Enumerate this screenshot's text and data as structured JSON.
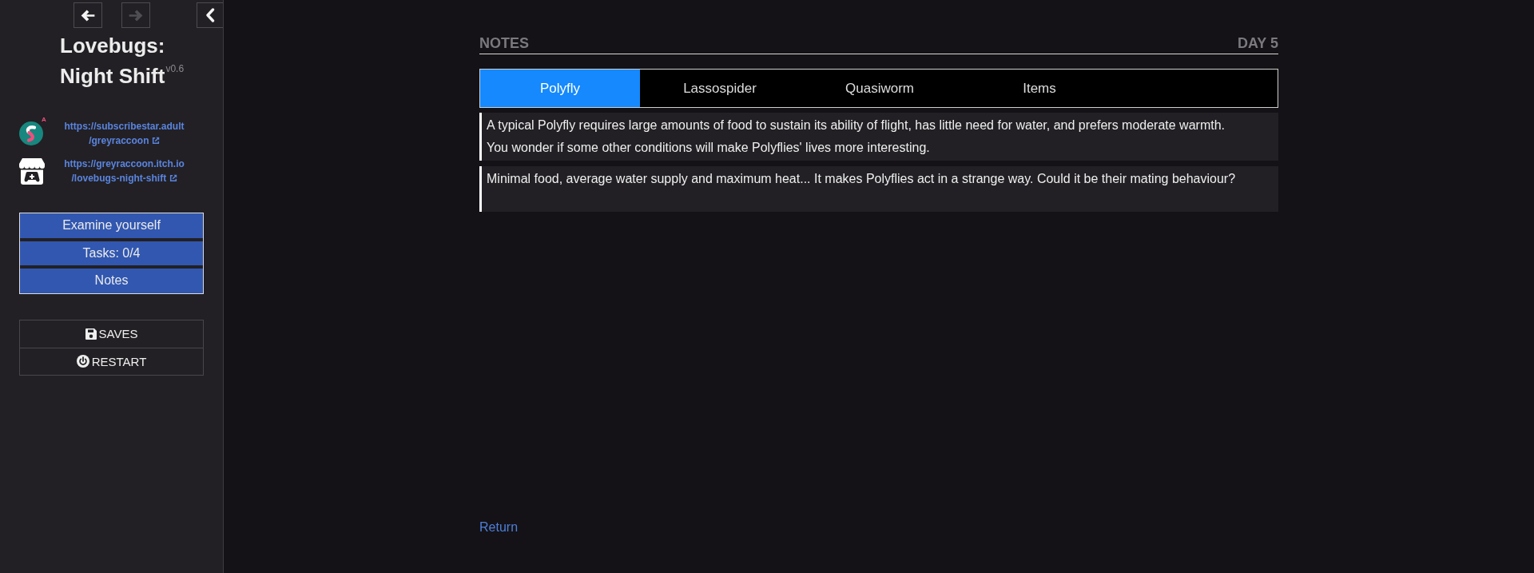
{
  "sidebar": {
    "history_buttons": [
      {
        "kind": "back",
        "disabled": false
      },
      {
        "kind": "forward",
        "disabled": true
      }
    ],
    "title": "Lovebugs: Night Shift",
    "version": "v0.6",
    "links": [
      {
        "kind": "subscribestar",
        "badge": "A",
        "lines": [
          "https://subscribestar.adult",
          "/greyraccoon"
        ]
      },
      {
        "kind": "itch",
        "lines": [
          "https://greyraccoon.itch.io",
          "/lovebugs-night-shift"
        ]
      }
    ],
    "menu": [
      "Examine yourself",
      "Tasks: 0/4",
      "Notes"
    ],
    "system_buttons": [
      {
        "kind": "saves",
        "label": "SAVES"
      },
      {
        "kind": "restart",
        "label": "RESTART"
      }
    ]
  },
  "main": {
    "title": "NOTES",
    "day": "DAY 5",
    "tabs": [
      {
        "label": "Polyfly",
        "selected": true
      },
      {
        "label": "Lassospider",
        "selected": false
      },
      {
        "label": "Quasiworm",
        "selected": false
      },
      {
        "label": "Items",
        "selected": false
      }
    ],
    "notes": [
      {
        "lines": [
          "A typical Polyfly requires large amounts of food to sustain its ability of flight, has little need for water, and prefers moderate warmth.",
          "You wonder if some other conditions will make Polyflies' lives more interesting."
        ]
      },
      {
        "lines": [
          "Minimal food, average water supply and maximum heat... It makes Polyflies act in a strange way. Could it be their mating behaviour?"
        ]
      }
    ],
    "return_link": "Return"
  }
}
